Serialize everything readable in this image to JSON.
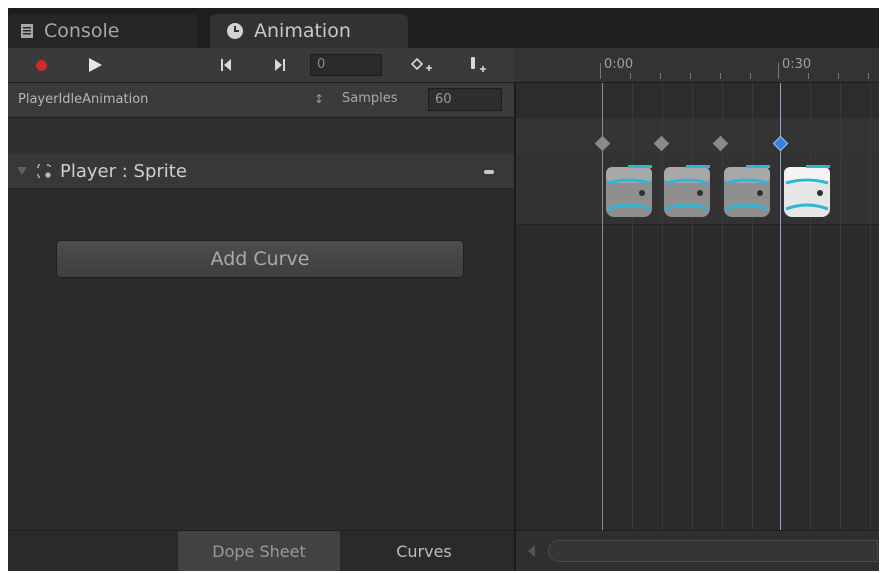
{
  "tabs": {
    "console_label": "Console",
    "animation_label": "Animation"
  },
  "toolbar": {
    "frame_value": "0",
    "ruler_labels": [
      "0:00",
      "0:30"
    ]
  },
  "clip": {
    "name": "PlayerIdleAnimation",
    "samples_label": "Samples",
    "samples_value": "60"
  },
  "property": {
    "label": "Player : Sprite"
  },
  "add_curve_label": "Add Curve",
  "bottom_tabs": {
    "dope_sheet": "Dope Sheet",
    "curves": "Curves"
  },
  "colors": {
    "record": "#d02a2a",
    "keyframe": "#8a8a8a",
    "keyframe_selected": "#3d7ee0",
    "sprite_accent": "#2fb6d6"
  },
  "icons": {
    "console_tab": "console-icon",
    "animation_tab": "clock-icon",
    "record": "record-icon",
    "play": "play-icon",
    "prev_key": "previous-keyframe-icon",
    "next_key": "next-keyframe-icon",
    "add_keyframe": "add-keyframe-icon",
    "add_event": "add-event-icon",
    "sprite_property": "sprite-icon",
    "remove_property": "minus-icon"
  },
  "timeline": {
    "keyframe_count": 4,
    "selected_keyframe_index": 3
  }
}
